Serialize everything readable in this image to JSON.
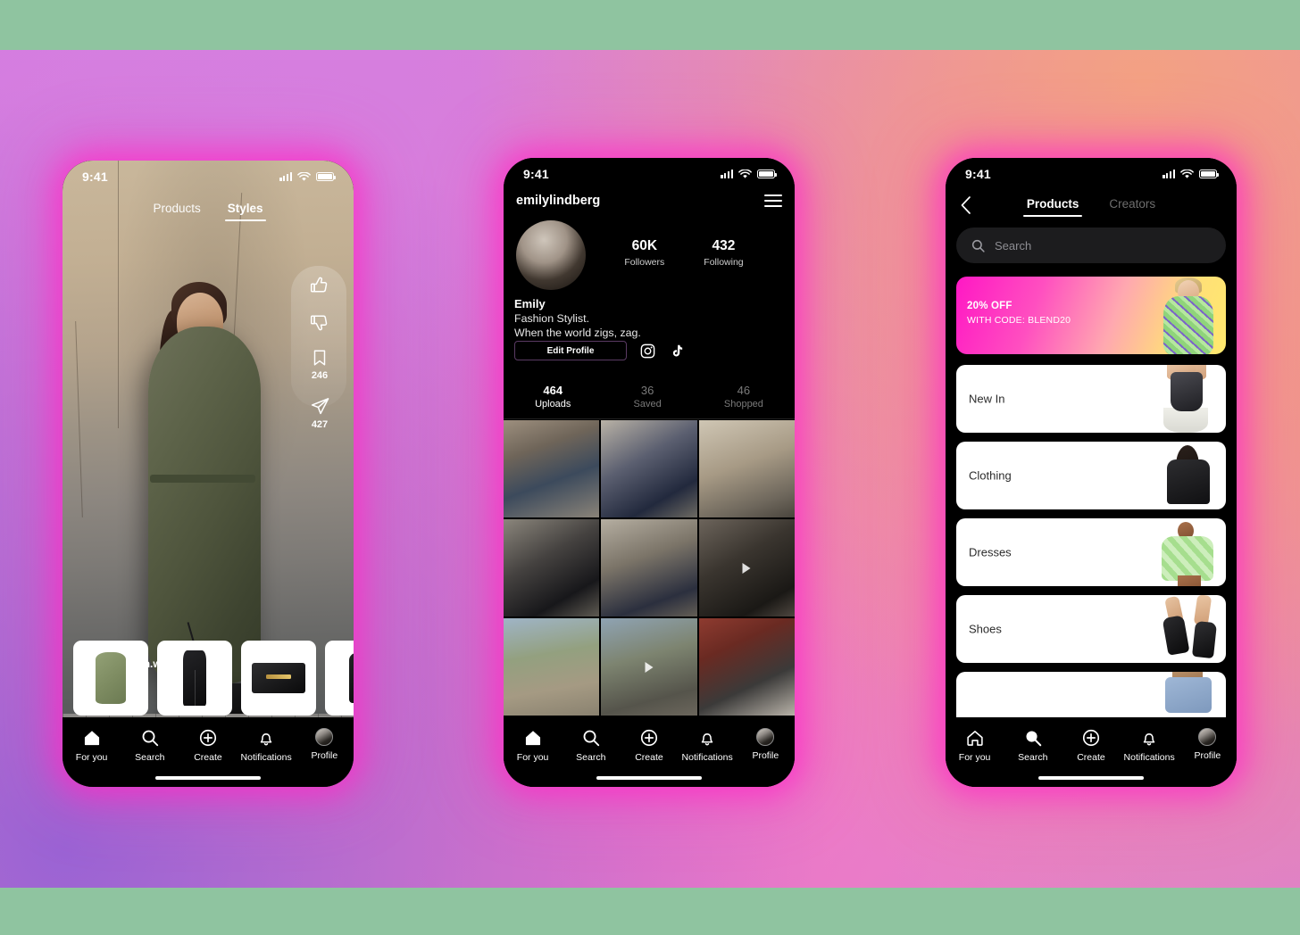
{
  "background": {
    "band_color": "#8fc4a0",
    "gradient_colors": [
      "#d57fe0",
      "#f3a183",
      "#ef8f90",
      "#9a63d4",
      "#ef74c8"
    ],
    "phone_glow": "#ff28c8"
  },
  "status_bar": {
    "time": "9:41",
    "signal_icon": "cellular-signal-icon",
    "wifi_icon": "wifi-icon",
    "battery_icon": "battery-icon"
  },
  "tab_bar": {
    "items": [
      {
        "label": "For you",
        "icon": "home-icon"
      },
      {
        "label": "Search",
        "icon": "search-icon"
      },
      {
        "label": "Create",
        "icon": "plus-circle-icon"
      },
      {
        "label": "Notifications",
        "icon": "bell-icon"
      },
      {
        "label": "Profile",
        "icon": "profile-avatar-icon"
      }
    ]
  },
  "phone1": {
    "name": "feed-screen",
    "tabs": [
      {
        "label": "Products",
        "active": false
      },
      {
        "label": "Styles",
        "active": true
      }
    ],
    "actions": [
      {
        "name": "thumbs-up-icon",
        "count": ""
      },
      {
        "name": "thumbs-down-icon",
        "count": ""
      },
      {
        "name": "bookmark-icon",
        "count": "246"
      },
      {
        "name": "share-icon",
        "count": "427"
      }
    ],
    "byline": {
      "prefix": "by",
      "creator": "mecah.wright",
      "avatar": "creator-avatar"
    },
    "products": [
      {
        "name": "green-trench-coat"
      },
      {
        "name": "black-trousers"
      },
      {
        "name": "black-leather-bag"
      },
      {
        "name": "black-boot"
      }
    ]
  },
  "phone2": {
    "name": "profile-screen",
    "handle": "emilylindberg",
    "menu_icon": "hamburger-menu-icon",
    "stats": [
      {
        "value": "60K",
        "label": "Followers"
      },
      {
        "value": "432",
        "label": "Following"
      }
    ],
    "display_name": "Emily",
    "bio_line1": "Fashion Stylist.",
    "bio_line2": "When the world zigs, zag.",
    "edit_button": "Edit Profile",
    "social_icons": [
      "instagram-icon",
      "tiktok-icon"
    ],
    "segments": [
      {
        "value": "464",
        "label": "Uploads",
        "active": true
      },
      {
        "value": "36",
        "label": "Saved",
        "active": false
      },
      {
        "value": "46",
        "label": "Shopped",
        "active": false
      }
    ],
    "grid": [
      {
        "name": "street-style-photo-1",
        "video": false
      },
      {
        "name": "street-style-photo-2",
        "video": false
      },
      {
        "name": "street-style-photo-3",
        "video": false
      },
      {
        "name": "street-style-photo-4",
        "video": false
      },
      {
        "name": "street-style-photo-5",
        "video": false
      },
      {
        "name": "street-style-photo-6",
        "video": true
      },
      {
        "name": "street-style-photo-7",
        "video": false
      },
      {
        "name": "street-style-photo-8",
        "video": true
      },
      {
        "name": "street-style-photo-9",
        "video": false
      }
    ]
  },
  "phone3": {
    "name": "search-categories-screen",
    "back_icon": "back-chevron-icon",
    "tabs": [
      {
        "label": "Products",
        "active": true
      },
      {
        "label": "Creators",
        "active": false
      }
    ],
    "search": {
      "placeholder": "Search",
      "icon": "search-icon",
      "value": ""
    },
    "promo": {
      "headline": "20% OFF",
      "subline": "WITH CODE: BLEND20",
      "gradient_from": "#ff18c4",
      "gradient_to": "#ffe96e"
    },
    "categories": [
      {
        "label": "New In",
        "image": "corset-top-model"
      },
      {
        "label": "Clothing",
        "image": "black-tee-model"
      },
      {
        "label": "Dresses",
        "image": "green-mini-dress-model"
      },
      {
        "label": "Shoes",
        "image": "black-chelsea-boots"
      },
      {
        "label": "",
        "image": "denim-jeans-model"
      }
    ]
  }
}
